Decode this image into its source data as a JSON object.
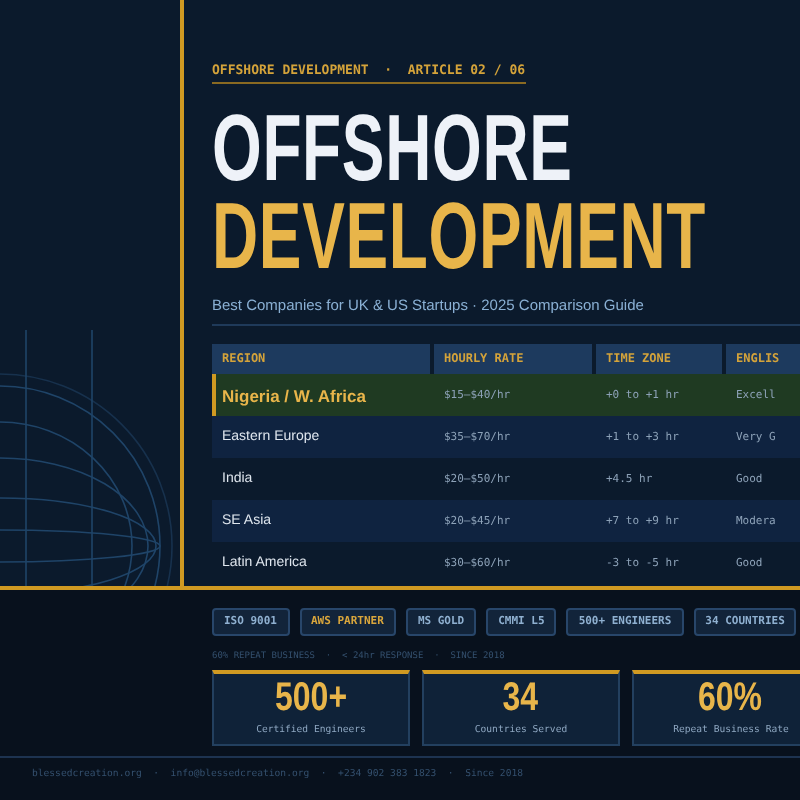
{
  "kicker": "OFFSHORE DEVELOPMENT  ·  ARTICLE 02 / 06",
  "title": {
    "line_1": "OFFSHORE",
    "line_2": "DEVELOPMENT"
  },
  "subtitle": "Best Companies for UK & US Startups · 2025 Comparison Guide",
  "table": {
    "columns": [
      "REGION",
      "HOURLY RATE",
      "TIME ZONE",
      "ENGLIS"
    ],
    "rows": [
      {
        "region": "Nigeria / W. Africa",
        "rate": "$15–$40/hr",
        "time_zone": "+0 to +1 hr",
        "english": "Excell",
        "selected": true
      },
      {
        "region": "Eastern Europe",
        "rate": "$35–$70/hr",
        "time_zone": "+1 to +3 hr",
        "english": "Very G",
        "selected": false
      },
      {
        "region": "India",
        "rate": "$20–$50/hr",
        "time_zone": "+4.5 hr",
        "english": "Good",
        "selected": false
      },
      {
        "region": "SE Asia",
        "rate": "$20–$45/hr",
        "time_zone": "+7 to +9 hr",
        "english": "Modera",
        "selected": false
      },
      {
        "region": "Latin America",
        "rate": "$30–$60/hr",
        "time_zone": "-3 to -5 hr",
        "english": "Good",
        "selected": false
      }
    ]
  },
  "badges": [
    {
      "label": "ISO 9001",
      "featured": false
    },
    {
      "label": "AWS PARTNER",
      "featured": true
    },
    {
      "label": "MS GOLD",
      "featured": false
    },
    {
      "label": "CMMI L5",
      "featured": false
    },
    {
      "label": "500+ ENGINEERS",
      "featured": false
    },
    {
      "label": "34 COUNTRIES",
      "featured": false
    }
  ],
  "tagline": "60% REPEAT BUSINESS  ·  < 24hr RESPONSE  ·  SINCE 2018",
  "stats": [
    {
      "value": "500+",
      "label": "Certified Engineers"
    },
    {
      "value": "34",
      "label": "Countries Served"
    },
    {
      "value": "60%",
      "label": "Repeat Business Rate"
    }
  ],
  "footer": "blessedcreation.org  ·  info@blessedcreation.org  ·  +234 902 383 1823  ·  Since 2018"
}
